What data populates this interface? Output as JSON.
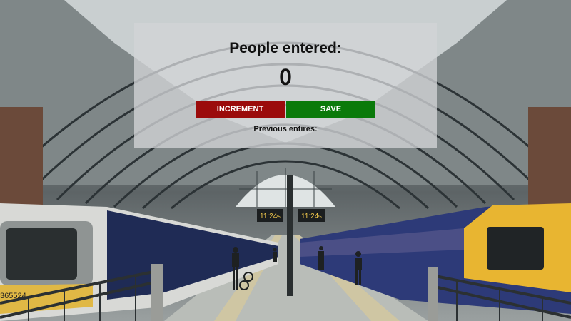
{
  "counter": {
    "title": "People entered:",
    "count": "0",
    "increment_label": "INCREMENT",
    "save_label": "SAVE",
    "previous_label": "Previous entires:"
  },
  "scene": {
    "clock_left": "11:24",
    "clock_left_sub": "25",
    "clock_right": "11:24",
    "clock_right_sub": "25",
    "train_number": "365524"
  },
  "colors": {
    "increment_button": "#9b0b0b",
    "save_button": "#0a7a0a",
    "train_yellow": "#e8b531"
  }
}
